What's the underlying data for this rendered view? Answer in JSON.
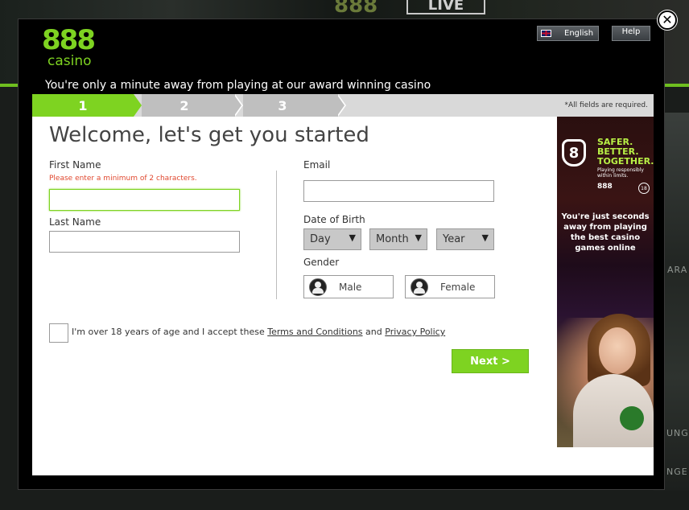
{
  "background": {
    "live_label": "LIVE",
    "brand_partial": "888",
    "side_text_1": "ARA",
    "side_text_2": "UNG",
    "side_text_3": "NGE"
  },
  "header": {
    "brand_number": "888",
    "brand_word": "casino",
    "language_label": "English",
    "help_label": "Help",
    "tagline": "You're only a minute away from playing at our award winning casino"
  },
  "steps": {
    "items": [
      "1",
      "2",
      "3"
    ],
    "active_step": "1",
    "required_note": "*All fields are required."
  },
  "form": {
    "heading": "Welcome, let's get you started",
    "first_name_label": "First Name",
    "first_name_error": "Please enter a minimum of 2 characters.",
    "first_name_value": "",
    "last_name_label": "Last Name",
    "last_name_value": "",
    "email_label": "Email",
    "email_value": "",
    "dob_label": "Date of Birth",
    "day_placeholder": "Day",
    "month_placeholder": "Month",
    "year_placeholder": "Year",
    "gender_label": "Gender",
    "gender_male": "Male",
    "gender_female": "Female",
    "terms_prefix": "I'm over 18 years of age and I accept these",
    "terms_link": "Terms and Conditions",
    "terms_and": "and",
    "privacy_link": "Privacy Policy",
    "next_label": "Next >"
  },
  "promo": {
    "badge_number": "8",
    "safer": "SAFER.",
    "better": "BETTER.",
    "together": "TOGETHER.",
    "small_line_1": "Playing responsibly",
    "small_line_2": "within limits.",
    "brand_responsible": "888",
    "age_badge": "18",
    "headline_1": "You're just seconds",
    "headline_2": "away from playing",
    "headline_3": "the best casino",
    "headline_4": "games online"
  },
  "colors": {
    "brand_green": "#7ed321",
    "error_red": "#e0482f",
    "modal_bg": "#000000"
  }
}
